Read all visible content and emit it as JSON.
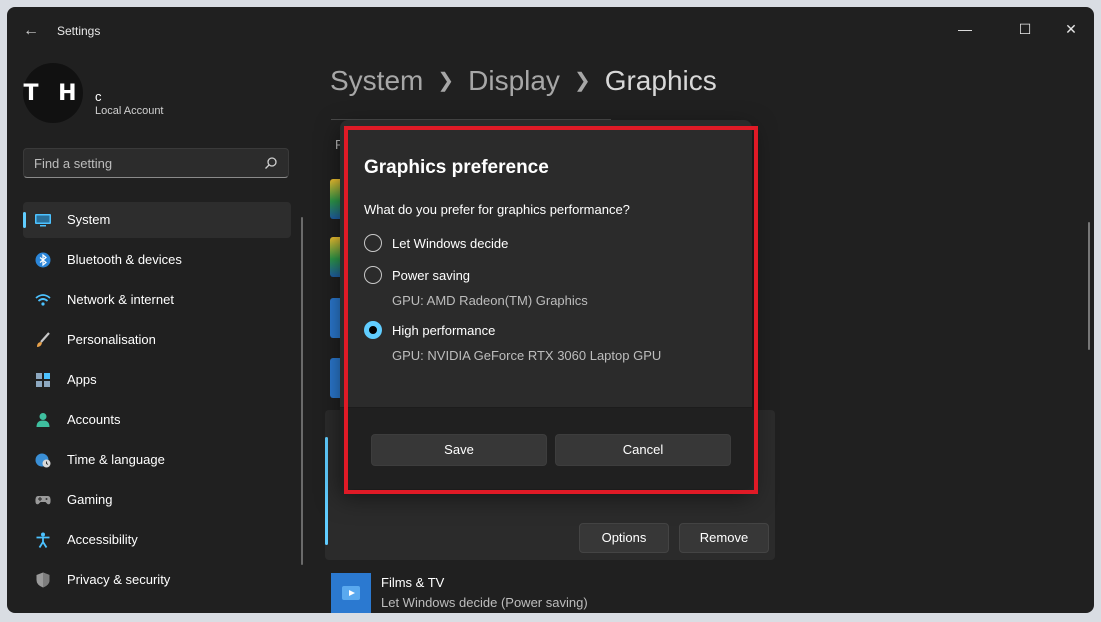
{
  "window": {
    "title": "Settings"
  },
  "profile": {
    "initials": "T H",
    "name": "c",
    "account_type": "Local Account"
  },
  "search": {
    "placeholder": "Find a setting"
  },
  "sidebar": {
    "items": [
      {
        "label": "System",
        "icon": "monitor-icon",
        "active": true
      },
      {
        "label": "Bluetooth & devices",
        "icon": "bluetooth-icon"
      },
      {
        "label": "Network & internet",
        "icon": "wifi-icon"
      },
      {
        "label": "Personalisation",
        "icon": "brush-icon"
      },
      {
        "label": "Apps",
        "icon": "apps-icon"
      },
      {
        "label": "Accounts",
        "icon": "person-icon"
      },
      {
        "label": "Time & language",
        "icon": "globe-clock-icon"
      },
      {
        "label": "Gaming",
        "icon": "gamepad-icon"
      },
      {
        "label": "Accessibility",
        "icon": "accessibility-icon"
      },
      {
        "label": "Privacy & security",
        "icon": "shield-icon"
      }
    ]
  },
  "breadcrumb": {
    "items": [
      "System",
      "Display"
    ],
    "current": "Graphics"
  },
  "content": {
    "peek_letter": "F",
    "card_buttons": {
      "options": "Options",
      "remove": "Remove"
    },
    "films": {
      "title": "Films & TV",
      "subtitle": "Let Windows decide (Power saving)"
    }
  },
  "dialog": {
    "title": "Graphics preference",
    "question": "What do you prefer for graphics performance?",
    "options": [
      {
        "label": "Let Windows decide",
        "subtitle": "",
        "selected": false
      },
      {
        "label": "Power saving",
        "subtitle": "GPU: AMD Radeon(TM) Graphics",
        "selected": false
      },
      {
        "label": "High performance",
        "subtitle": "GPU: NVIDIA GeForce RTX 3060 Laptop GPU",
        "selected": true
      }
    ],
    "save_label": "Save",
    "cancel_label": "Cancel"
  },
  "colors": {
    "accent": "#60cdff",
    "highlight": "#e01a26",
    "background": "#202020",
    "dialog": "#2b2b2b"
  }
}
